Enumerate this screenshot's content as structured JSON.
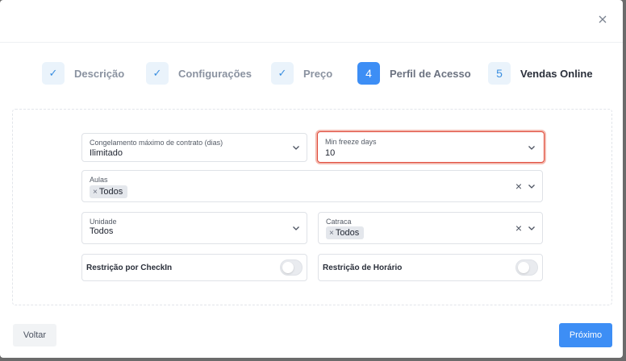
{
  "window": {
    "close_icon": "close-icon"
  },
  "steps": [
    {
      "label": "Descrição",
      "badge": "✓",
      "state": "done"
    },
    {
      "label": "Configurações",
      "badge": "✓",
      "state": "done"
    },
    {
      "label": "Preço",
      "badge": "✓",
      "state": "done"
    },
    {
      "label": "Perfil de Acesso",
      "badge": "4",
      "state": "active"
    },
    {
      "label": "Vendas Online",
      "badge": "5",
      "state": "todo"
    }
  ],
  "form": {
    "congelamento": {
      "label": "Congelamento máximo de contrato (dias)",
      "value": "Ilimitado"
    },
    "min_freeze": {
      "label": "Min freeze days",
      "value": "10"
    },
    "aulas": {
      "label": "Aulas",
      "chip": "Todos",
      "chip_x": "×"
    },
    "unidade": {
      "label": "Unidade",
      "value": "Todos"
    },
    "catraca": {
      "label": "Catraca",
      "chip": "Todos",
      "chip_x": "×"
    },
    "restricao_checkin": {
      "label": "Restrição por CheckIn",
      "on": false
    },
    "restricao_horario": {
      "label": "Restrição de Horário",
      "on": false
    },
    "clear_glyph": "×"
  },
  "footer": {
    "back_label": "Voltar",
    "next_label": "Próximo"
  },
  "colors": {
    "primary": "#3d8ef5",
    "focus_border": "#e04a3a"
  }
}
